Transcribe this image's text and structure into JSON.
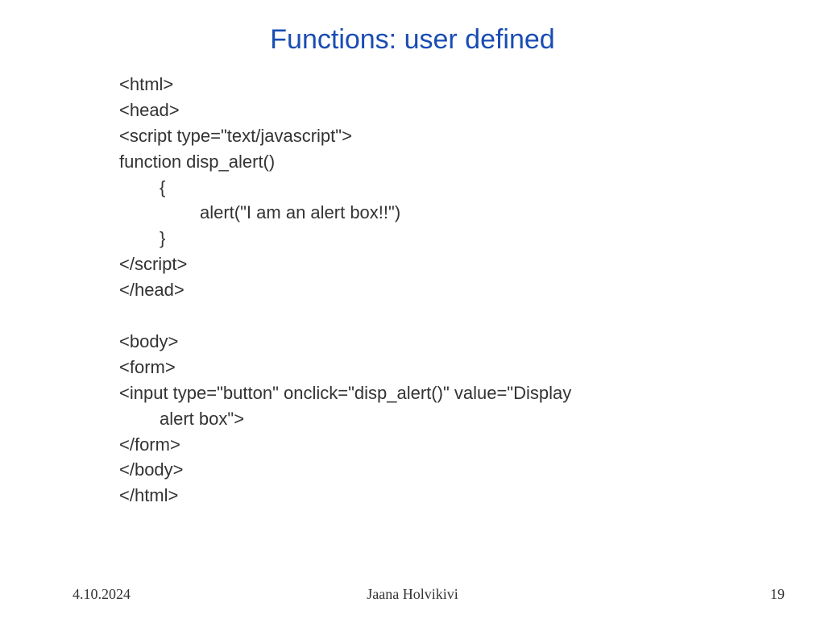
{
  "title": "Functions: user defined",
  "code": {
    "l1": "<html>",
    "l2": "<head>",
    "l3": "<script type=\"text/javascript\">",
    "l4": "function disp_alert()",
    "l5": "{",
    "l6": "alert(\"I am an alert box!!\")",
    "l7": "}",
    "l8": "</script>",
    "l9": "</head>",
    "l10": "<body>",
    "l11": "<form>",
    "l12a": "<input type=\"button\" onclick=\"disp_alert()\" value=\"Display",
    "l12b": "alert box\">",
    "l13": "</form>",
    "l14": "</body>",
    "l15": "</html>"
  },
  "footer": {
    "date": "4.10.2024",
    "author": "Jaana Holvikivi",
    "page": "19"
  }
}
